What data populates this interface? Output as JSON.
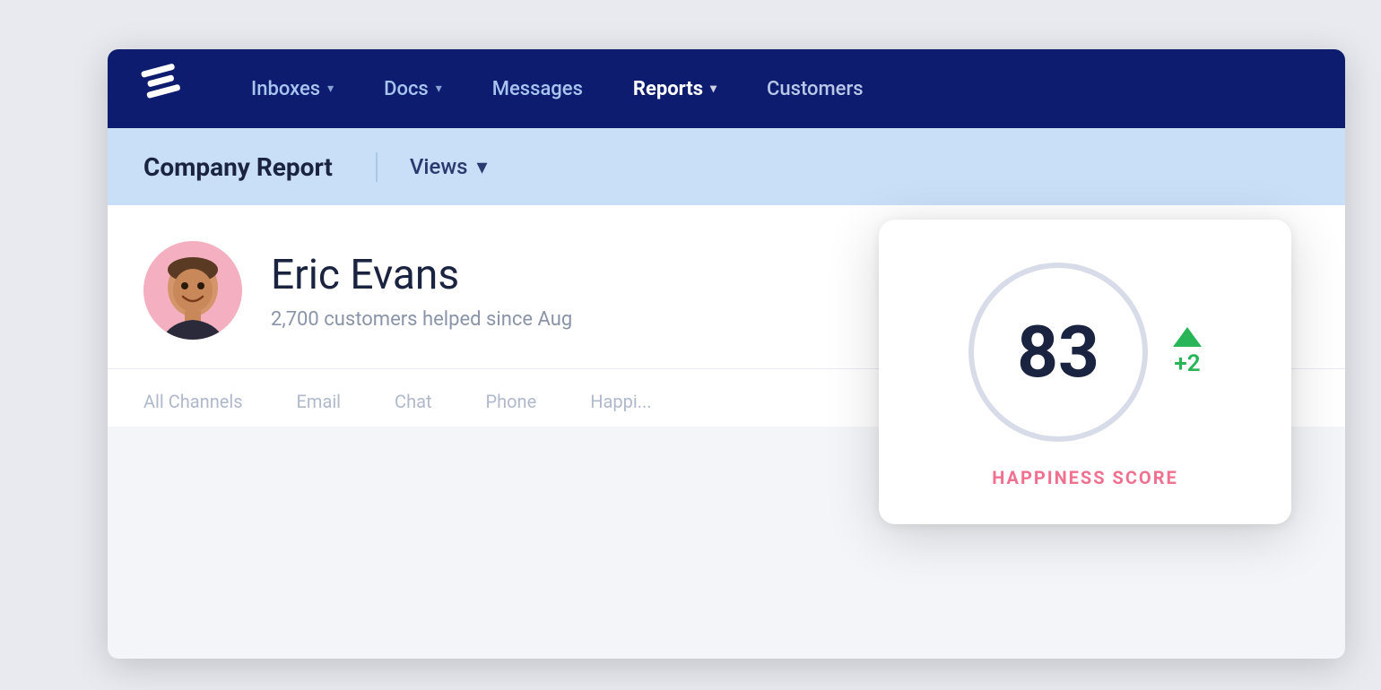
{
  "nav": {
    "items": [
      {
        "id": "inboxes",
        "label": "Inboxes",
        "hasDropdown": true,
        "active": false
      },
      {
        "id": "docs",
        "label": "Docs",
        "hasDropdown": true,
        "active": false
      },
      {
        "id": "messages",
        "label": "Messages",
        "hasDropdown": false,
        "active": false
      },
      {
        "id": "reports",
        "label": "Reports",
        "hasDropdown": true,
        "active": true
      },
      {
        "id": "customers",
        "label": "Customers",
        "hasDropdown": false,
        "active": false
      }
    ]
  },
  "sub_header": {
    "title": "Company Report",
    "views_label": "Views",
    "views_chevron": "▾"
  },
  "agent": {
    "name": "Eric Evans",
    "subtitle": "2,700 customers helped since Aug"
  },
  "channel_tabs": [
    {
      "id": "all",
      "label": "All Channels"
    },
    {
      "id": "email",
      "label": "Email"
    },
    {
      "id": "chat",
      "label": "Chat"
    },
    {
      "id": "phone",
      "label": "Phone"
    },
    {
      "id": "happiness",
      "label": "Happi..."
    }
  ],
  "happiness_card": {
    "score": "83",
    "delta": "+2",
    "label": "HAPPINESS SCORE"
  }
}
